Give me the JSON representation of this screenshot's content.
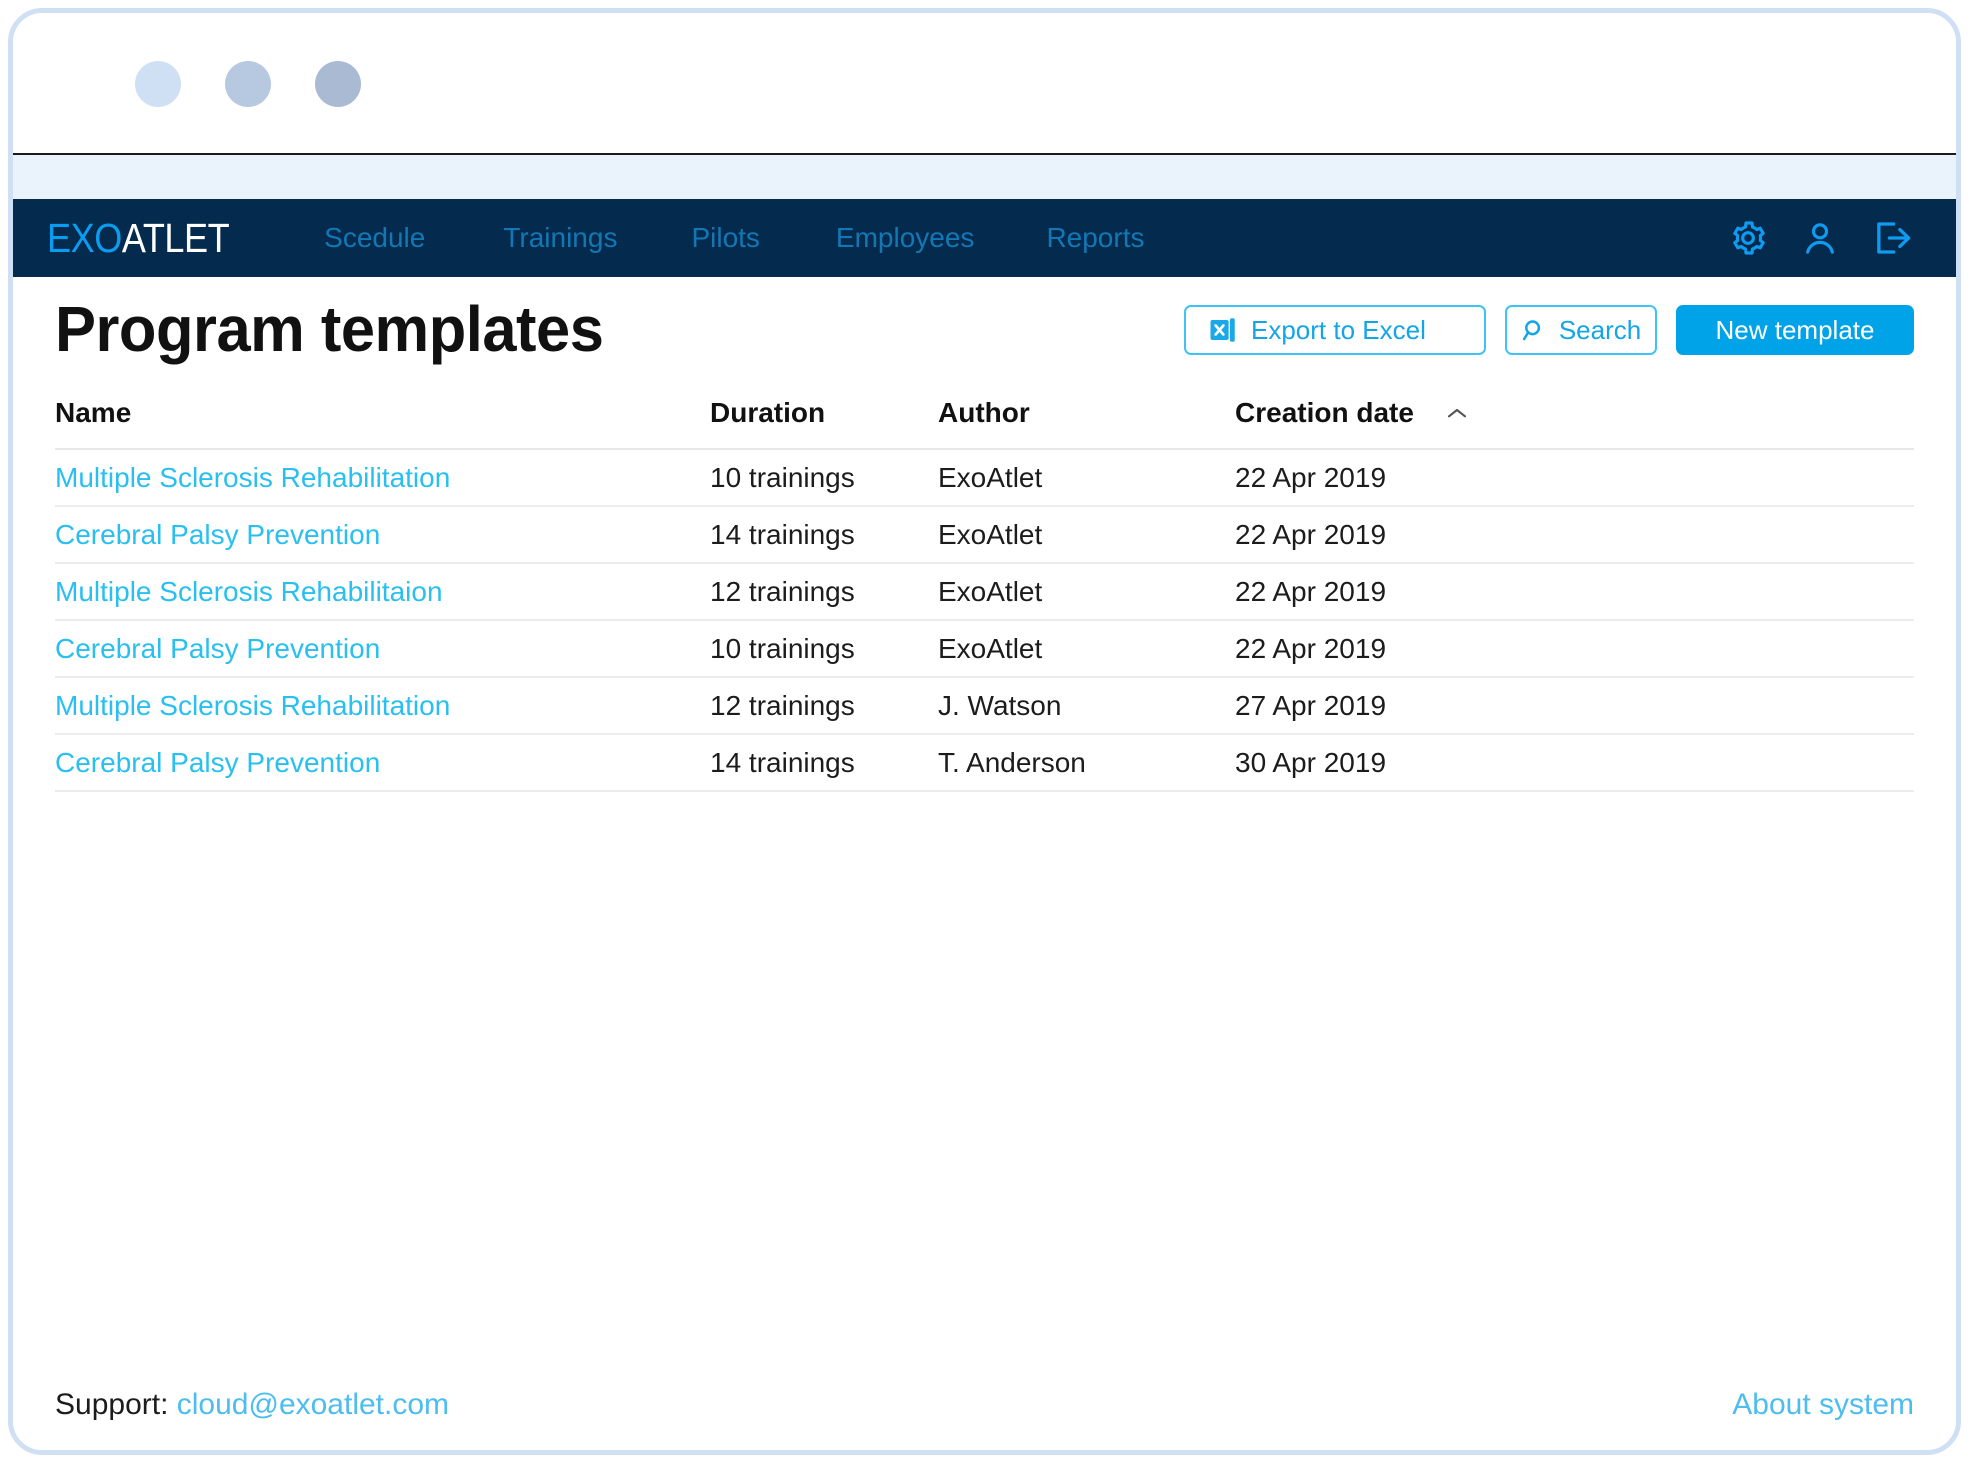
{
  "window": {
    "dots": [
      "window-dot-1",
      "window-dot-2",
      "window-dot-3"
    ]
  },
  "header": {
    "logo_primary": "EXO",
    "logo_secondary": "ATLET",
    "nav": [
      {
        "label": "Scedule"
      },
      {
        "label": "Trainings"
      },
      {
        "label": "Pilots"
      },
      {
        "label": "Employees"
      },
      {
        "label": "Reports"
      }
    ],
    "icons": [
      {
        "name": "gear-icon"
      },
      {
        "name": "user-icon"
      },
      {
        "name": "logout-icon"
      }
    ]
  },
  "main": {
    "title": "Program templates",
    "actions": {
      "export_label": "Export to Excel",
      "search_label": "Search",
      "new_template_label": "New template"
    },
    "table": {
      "columns": [
        "Name",
        "Duration",
        "Author",
        "Creation date"
      ],
      "sorted_by": "Creation date",
      "sort_direction": "asc",
      "rows": [
        {
          "name": "Multiple Sclerosis Rehabilitation",
          "duration": "10 trainings",
          "author": "ExoAtlet",
          "creation_date": "22 Apr 2019"
        },
        {
          "name": "Cerebral Palsy  Prevention",
          "duration": "14 trainings",
          "author": "ExoAtlet",
          "creation_date": "22 Apr 2019"
        },
        {
          "name": "Multiple Sclerosis Rehabilitaion",
          "duration": "12 trainings",
          "author": "ExoAtlet",
          "creation_date": "22 Apr 2019"
        },
        {
          "name": "Cerebral Palsy  Prevention",
          "duration": "10 trainings",
          "author": "ExoAtlet",
          "creation_date": "22 Apr 2019"
        },
        {
          "name": "Multiple Sclerosis Rehabilitation",
          "duration": "12 trainings",
          "author": "J. Watson",
          "creation_date": "27 Apr 2019"
        },
        {
          "name": "Cerebral Palsy  Prevention",
          "duration": "14 trainings",
          "author": "T. Anderson",
          "creation_date": "30 Apr 2019"
        }
      ]
    }
  },
  "footer": {
    "support_label": "Support:",
    "support_email": "cloud@exoatlet.com",
    "about_label": "About system"
  },
  "colors": {
    "header_navy": "#042A4D",
    "nav_link": "#1278B5",
    "logo_accent": "#0A9CF0",
    "primary_button": "#00A3E8",
    "link_cyan": "#29BFF0",
    "footer_link": "#4DBDF0",
    "window_border": "#CFDFF4",
    "chrome_band": "#EAF2FB"
  }
}
